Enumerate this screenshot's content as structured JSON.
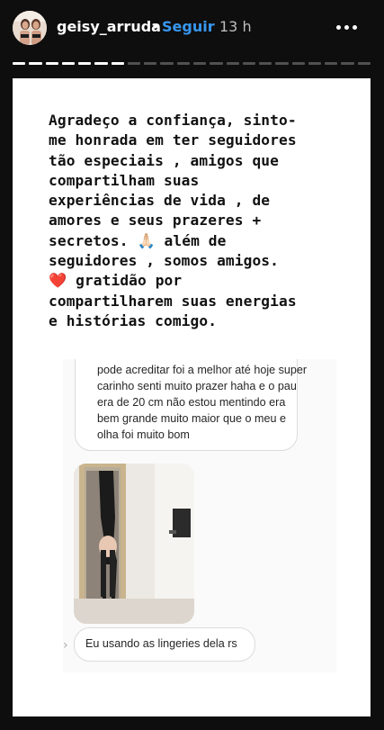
{
  "header": {
    "username": "geisy_arruda",
    "separator": "•",
    "follow_label": "Seguir",
    "time": "13 h",
    "avatar_icon": "profile-avatar",
    "more_icon": "more-options-icon"
  },
  "progress": {
    "total": 22,
    "completed": 7
  },
  "story": {
    "caption": "Agradeço a confiança, sinto-\nme honrada em ter seguidores\ntão especiais , amigos que\ncompartilham suas\nexperiências de vida , de\namores e seus prazeres +\nsecretos. 🙏🏻 além de\nseguidores , somos amigos.\n❤️ gratidão por\ncompartilharem suas energias\ne histórias comigo.",
    "chat": {
      "message_text": "pode acreditar foi a melhor até hoje super carinho senti muito prazer haha e o pau era de 20 cm não estou mentindo era bem grande muito maior que o meu e olha foi muito bom",
      "photo_icon": "mirror-selfie-photo",
      "reply_text": "Eu usando as lingeries dela rs",
      "chevron": "›"
    }
  },
  "colors": {
    "background": "#0e0e0e",
    "follow": "#3897f0",
    "story_bg": "#ffffff",
    "text_dark": "#111111"
  }
}
